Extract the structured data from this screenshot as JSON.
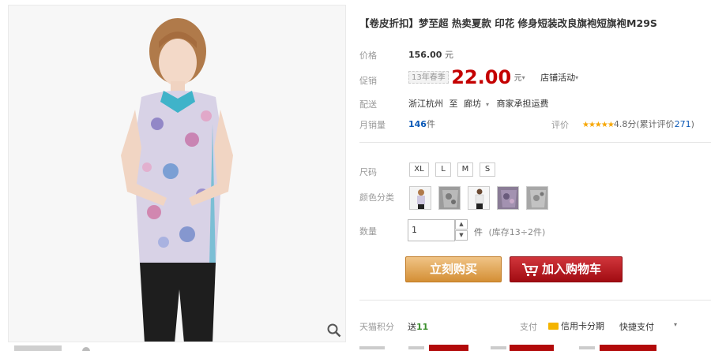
{
  "product": {
    "title": "【卷皮折扣】梦至超 热卖夏款 印花 修身短装改良旗袍短旗袍M29S"
  },
  "price": {
    "label": "价格",
    "original": "156.00",
    "unit": "元"
  },
  "promo": {
    "label": "促销",
    "tag": "13年春季",
    "price": "22.00",
    "unit": "元",
    "activity": "店铺活动"
  },
  "shipping": {
    "label": "配送",
    "from": "浙江杭州",
    "to_word": "至",
    "to": "廊坊",
    "fee": "商家承担运费"
  },
  "sales": {
    "label": "月销量",
    "count": "146",
    "unit": "件",
    "rating_label": "评价",
    "stars": "★★★★★",
    "score": "4.8分(累计评价",
    "review_count": "271",
    "close_paren": ")"
  },
  "options": {
    "size_label": "尺码",
    "sizes": [
      "XL",
      "L",
      "M",
      "S"
    ],
    "color_label": "颜色分类"
  },
  "quantity": {
    "label": "数量",
    "value": "1",
    "unit": "件",
    "stock": "(库存13÷2件)"
  },
  "actions": {
    "buy": "立刻购买",
    "cart": "加入购物车"
  },
  "bottom": {
    "points_label": "天猫积分",
    "points_prefix": "送",
    "points_value": "11",
    "pay_label": "支付",
    "credit": "信用卡分期",
    "fast": "快捷支付"
  },
  "colors": {
    "price_red": "#c40000",
    "buy_orange": "#d48f35",
    "cart_red": "#a10c12",
    "link_blue": "#0a58b6",
    "star_gold": "#f7a600"
  },
  "icons": [
    "zoom-icon",
    "cart-icon",
    "credit-card-icon",
    "chevron-down-icon",
    "stepper-up-icon",
    "stepper-down-icon"
  ]
}
